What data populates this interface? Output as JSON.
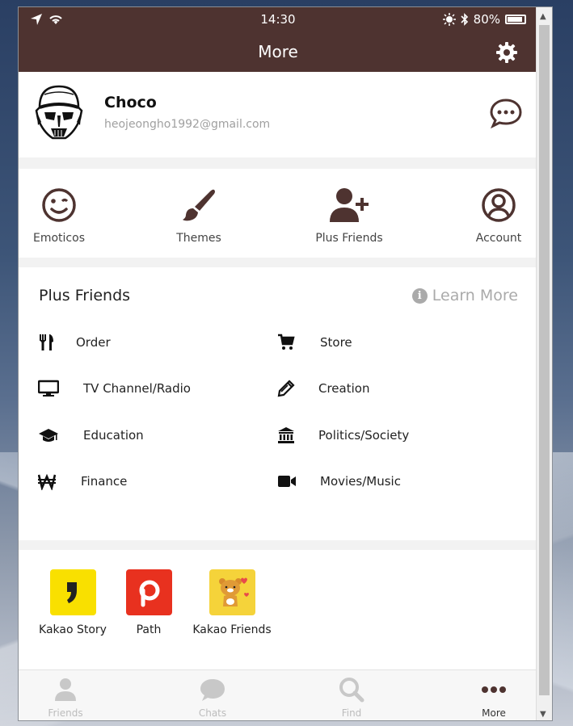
{
  "status_bar": {
    "time": "14:30",
    "battery": "80%"
  },
  "header": {
    "title": "More"
  },
  "profile": {
    "name": "Choco",
    "email": "heojeongho1992@gmail.com"
  },
  "quick_actions": [
    {
      "label": "Emoticos",
      "icon": "smile-icon"
    },
    {
      "label": "Themes",
      "icon": "paintbrush-icon"
    },
    {
      "label": "Plus Friends",
      "icon": "add-user-icon"
    },
    {
      "label": "Account",
      "icon": "user-circle-icon"
    }
  ],
  "plus_friends": {
    "title": "Plus Friends",
    "learn_more": "Learn More",
    "categories": [
      {
        "label": "Order",
        "icon": "utensils-icon"
      },
      {
        "label": "Store",
        "icon": "cart-icon"
      },
      {
        "label": "TV Channel/Radio",
        "icon": "monitor-icon"
      },
      {
        "label": "Creation",
        "icon": "pencil-icon"
      },
      {
        "label": "Education",
        "icon": "graduation-cap-icon"
      },
      {
        "label": "Politics/Society",
        "icon": "institution-icon"
      },
      {
        "label": "Finance",
        "icon": "won-icon"
      },
      {
        "label": "Movies/Music",
        "icon": "video-camera-icon"
      }
    ]
  },
  "apps": [
    {
      "label": "Kakao Story",
      "color": "#f9e000"
    },
    {
      "label": "Path",
      "color": "#e8311f"
    },
    {
      "label": "Kakao Friends",
      "color": "#f5d33a"
    }
  ],
  "bottom_nav": [
    {
      "label": "Friends",
      "icon": "person-icon"
    },
    {
      "label": "Chats",
      "icon": "chat-icon"
    },
    {
      "label": "Find",
      "icon": "search-icon"
    },
    {
      "label": "More",
      "icon": "ellipsis-icon"
    }
  ],
  "colors": {
    "header": "#4e3330",
    "icon_brown": "#4e3330",
    "muted": "#bcbcbc"
  }
}
